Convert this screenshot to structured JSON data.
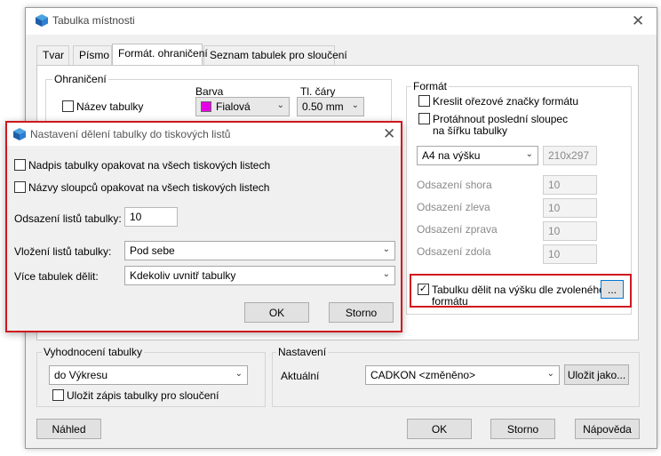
{
  "main_window": {
    "title": "Tabulka místnosti",
    "tabs": [
      {
        "label": "Tvar"
      },
      {
        "label": "Písmo"
      },
      {
        "label": "Formát. ohraničení"
      },
      {
        "label": "Seznam tabulek pro sloučení"
      }
    ],
    "border_group": {
      "label": "Ohraničení",
      "color_header": "Barva",
      "line_header": "Tl. čáry",
      "name_row_label": "Název tabulky",
      "name_row_color": "Fialová",
      "name_row_color_swatch": "#e600e6",
      "name_row_line": "0.50 mm"
    },
    "format_group": {
      "label": "Formát",
      "crop_marks_label": "Kreslit ořezové značky formátu",
      "stretch_label_1": "Protáhnout poslední sloupec",
      "stretch_label_2": "na šířku tabulky",
      "paper_size": "A4 na výšku",
      "paper_dims": "210x297",
      "offsets": [
        {
          "label": "Odsazení shora",
          "value": "10"
        },
        {
          "label": "Odsazení zleva",
          "value": "10"
        },
        {
          "label": "Odsazení zprava",
          "value": "10"
        },
        {
          "label": "Odsazení zdola",
          "value": "10"
        }
      ],
      "split_label_1": "Tabulku dělit na výšku dle zvoleného",
      "split_label_2": "formátu",
      "split_checked": true,
      "split_button": "..."
    },
    "evaluation_group": {
      "label": "Vyhodnocení tabulky",
      "target": "do Výkresu",
      "save_label": "Uložit zápis tabulky pro sloučení"
    },
    "settings_group": {
      "label": "Nastavení",
      "current_label": "Aktuální",
      "current_value": "CADKON <změněno>",
      "save_as_button": "Uložit jako..."
    },
    "buttons": {
      "preview": "Náhled",
      "ok": "OK",
      "cancel": "Storno",
      "help": "Nápověda"
    }
  },
  "split_dialog": {
    "title": "Nastavení dělení tabulky do tiskových listů",
    "repeat_caption_label": "Nadpis tabulky opakovat na všech tiskových listech",
    "repeat_columns_label": "Názvy sloupců opakovat na všech tiskových listech",
    "sheet_offset_label": "Odsazení listů tabulky:",
    "sheet_offset_value": "10",
    "insertion_label": "Vložení listů tabulky:",
    "insertion_value": "Pod sebe",
    "multi_split_label": "Více tabulek dělit:",
    "multi_split_value": "Kdekoliv uvnitř tabulky",
    "ok_button": "OK",
    "cancel_button": "Storno"
  },
  "colors": {
    "highlight_red": "#d0181e",
    "focus_blue": "#0078d7"
  },
  "icons": {
    "app": "cadkon-app-icon",
    "close": "close-icon",
    "dropdown": "chevron-down-icon",
    "checkmark": "checkmark-icon"
  }
}
